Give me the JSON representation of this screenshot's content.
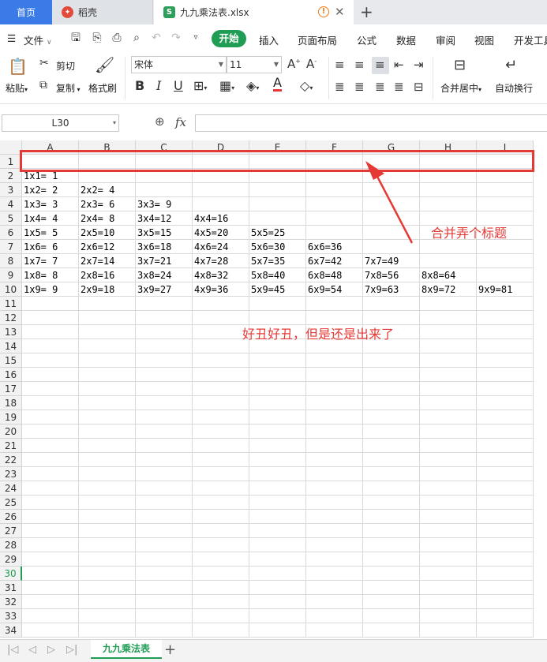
{
  "tabs": {
    "home": "首页",
    "daoke": "稻壳",
    "file": "九九乘法表.xlsx"
  },
  "menu": {
    "file": "文件",
    "items": [
      "开始",
      "插入",
      "页面布局",
      "公式",
      "数据",
      "审阅",
      "视图",
      "开发工具"
    ]
  },
  "ribbon": {
    "paste": "粘贴",
    "cut": "剪切",
    "copy": "复制",
    "format_painter": "格式刷",
    "font_name": "宋体",
    "font_size": "11",
    "merge_center": "合并居中",
    "wrap_text": "自动换行"
  },
  "formula_bar": {
    "name_box": "L30",
    "fx": "fx",
    "content": ""
  },
  "grid": {
    "columns": [
      "A",
      "B",
      "C",
      "D",
      "E",
      "F",
      "G",
      "H",
      "I"
    ],
    "row_numbers": [
      "1",
      "2",
      "3",
      "4",
      "5",
      "6",
      "7",
      "8",
      "9",
      "10",
      "11",
      "12",
      "13",
      "14",
      "15",
      "16",
      "17",
      "18",
      "19",
      "20",
      "21",
      "22",
      "23",
      "24",
      "25",
      "26",
      "27",
      "28",
      "29",
      "30",
      "31",
      "32",
      "33",
      "34"
    ],
    "selected_row": "30",
    "rows": [
      [],
      [
        "1x1= 1"
      ],
      [
        "1x2= 2",
        "2x2= 4"
      ],
      [
        "1x3= 3",
        "2x3= 6",
        "3x3= 9"
      ],
      [
        "1x4= 4",
        "2x4= 8",
        "3x4=12",
        "4x4=16"
      ],
      [
        "1x5= 5",
        "2x5=10",
        "3x5=15",
        "4x5=20",
        "5x5=25"
      ],
      [
        "1x6= 6",
        "2x6=12",
        "3x6=18",
        "4x6=24",
        "5x6=30",
        "6x6=36"
      ],
      [
        "1x7= 7",
        "2x7=14",
        "3x7=21",
        "4x7=28",
        "5x7=35",
        "6x7=42",
        "7x7=49"
      ],
      [
        "1x8= 8",
        "2x8=16",
        "3x8=24",
        "4x8=32",
        "5x8=40",
        "6x8=48",
        "7x8=56",
        "8x8=64"
      ],
      [
        "1x9= 9",
        "2x9=18",
        "3x9=27",
        "4x9=36",
        "5x9=45",
        "6x9=54",
        "7x9=63",
        "8x9=72",
        "9x9=81"
      ]
    ]
  },
  "annotations": {
    "merge_note": "合并弄个标题",
    "comment": "好丑好丑，但是还是出来了",
    "color": "#e53935"
  },
  "sheets": {
    "active": "九九乘法表"
  },
  "colors": {
    "accent": "#1f9d55",
    "home_tab": "#3b7be8"
  }
}
